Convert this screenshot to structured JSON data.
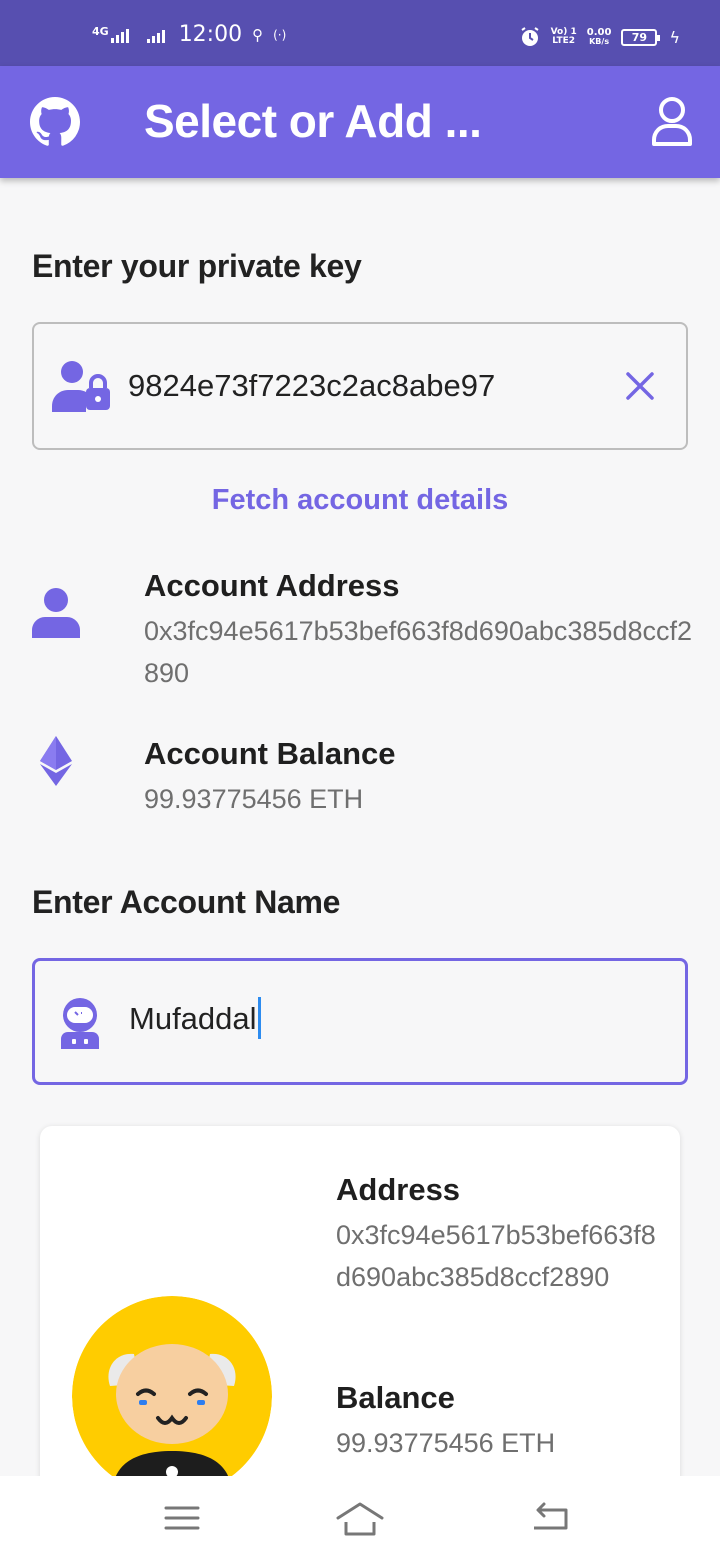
{
  "status_bar": {
    "network": "4G",
    "time": "12:00",
    "volte": "Vo) 1",
    "lte": "LTE2",
    "speed_value": "0.00",
    "speed_unit": "KB/s",
    "battery": "79"
  },
  "app_bar": {
    "title": "Select or Add ...",
    "left_icon": "github-icon",
    "right_icon": "user-profile-icon"
  },
  "private_key": {
    "label": "Enter your private key",
    "value": "9824e73f7223c2ac8abe97",
    "icon": "user-lock-icon",
    "clear_icon": "close-icon"
  },
  "fetch_button": "Fetch account details",
  "account_address": {
    "title": "Account Address",
    "value": "0x3fc94e5617b53bef663f8d690abc385d8ccf2890",
    "icon": "user-icon"
  },
  "account_balance": {
    "title": "Account Balance",
    "value": "99.93775456 ETH",
    "icon": "ethereum-icon"
  },
  "account_name": {
    "label": "Enter Account Name",
    "value": "Mufaddal",
    "icon": "astronaut-icon"
  },
  "card": {
    "address_title": "Address",
    "address_value": "0x3fc94e5617b53bef663f8d690abc385d8ccf2890",
    "balance_title": "Balance",
    "balance_value": "99.93775456 ETH",
    "avatar": "cat-avatar"
  },
  "colors": {
    "primary": "#7466e3",
    "status_bar": "#574fb0",
    "text_muted": "#6f6f6f"
  },
  "nav": {
    "menu_icon": "menu-icon",
    "home_icon": "home-icon",
    "back_icon": "back-icon"
  }
}
